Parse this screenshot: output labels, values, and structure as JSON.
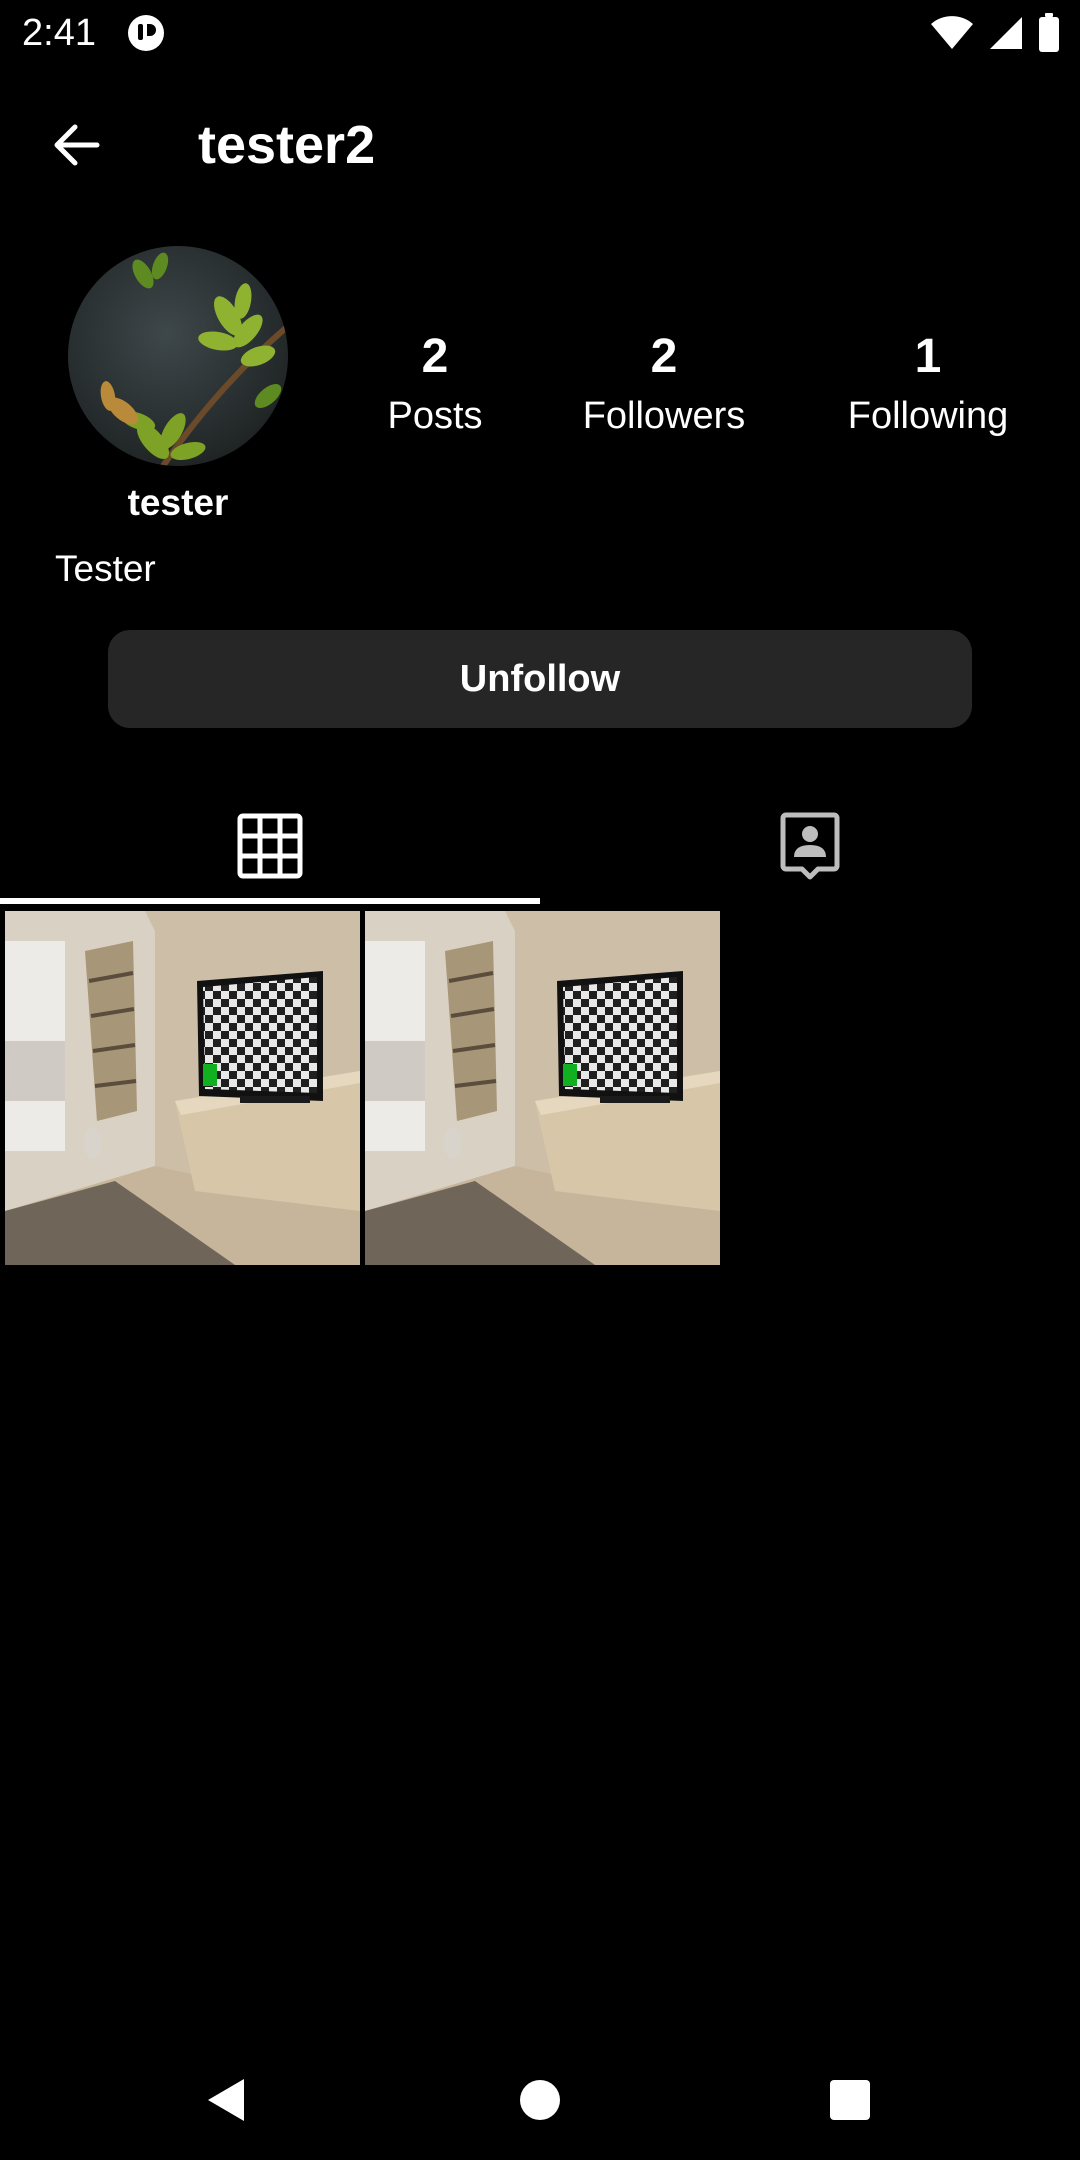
{
  "status_bar": {
    "time": "2:41",
    "icons": [
      "app-notification-icon",
      "wifi-icon",
      "cell-signal-icon",
      "battery-icon"
    ]
  },
  "header": {
    "title": "tester2",
    "back_icon": "arrow-left-icon"
  },
  "profile": {
    "display_name": "tester",
    "bio": "Tester",
    "stats": {
      "posts": {
        "count": "2",
        "label": "Posts"
      },
      "followers": {
        "count": "2",
        "label": "Followers"
      },
      "following": {
        "count": "1",
        "label": "Following"
      }
    },
    "unfollow_label": "Unfollow"
  },
  "tabs": [
    {
      "icon": "grid-icon",
      "selected": true
    },
    {
      "icon": "tagged-person-icon",
      "selected": false
    }
  ],
  "posts": [
    {
      "icon": "post-thumbnail"
    },
    {
      "icon": "post-thumbnail"
    }
  ],
  "nav_bar": {
    "icons": [
      "nav-back-icon",
      "nav-home-icon",
      "nav-recents-icon"
    ]
  },
  "colors": {
    "background": "#000000",
    "text": "#ffffff",
    "button_bg": "#262626",
    "tab_indicator": "#ffffff"
  }
}
